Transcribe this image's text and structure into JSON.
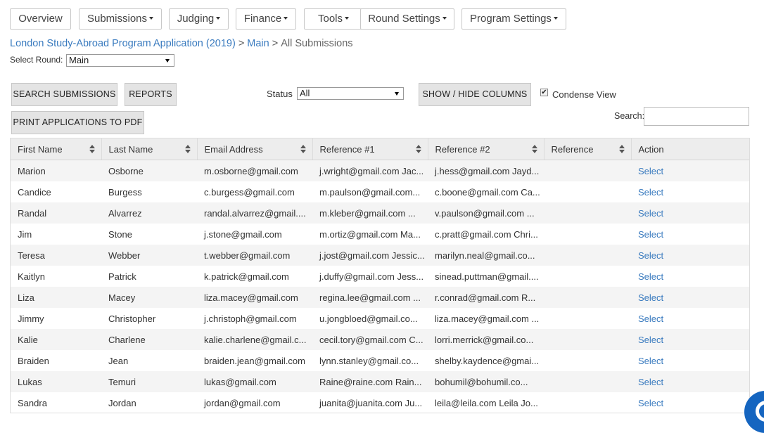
{
  "nav": [
    {
      "label": "Overview",
      "dropdown": false
    },
    {
      "label": "Submissions",
      "dropdown": true
    },
    {
      "label": "Judging",
      "dropdown": true
    },
    {
      "label": "Finance",
      "dropdown": true
    },
    {
      "label": "Tools",
      "dropdown": true
    },
    {
      "label": "Round Settings",
      "dropdown": true
    },
    {
      "label": "Program Settings",
      "dropdown": true
    }
  ],
  "breadcrumb": {
    "program": "London Study-Abroad Program Application (2019)",
    "round": "Main",
    "current": "All Submissions",
    "separator": ">"
  },
  "round_select": {
    "label": "Select Round:",
    "value": "Main"
  },
  "toolbar": {
    "search_submissions": "SEARCH SUBMISSIONS",
    "reports": "REPORTS",
    "print_pdf": "PRINT APPLICATIONS TO PDF",
    "status_label": "Status",
    "status_value": "All",
    "show_hide_columns": "SHOW / HIDE COLUMNS",
    "condense_label": "Condense View",
    "condense_checked": true,
    "search_label": "Search:",
    "search_value": ""
  },
  "table": {
    "columns": [
      "First Name",
      "Last Name",
      "Email Address",
      "Reference #1",
      "Reference #2",
      "Reference",
      "Action"
    ],
    "rows": [
      [
        "Marion",
        "Osborne",
        "m.osborne@gmail.com",
        "j.wright@gmail.com Jac...",
        "j.hess@gmail.com Jayd...",
        "",
        "Select"
      ],
      [
        "Candice",
        "Burgess",
        "c.burgess@gmail.com",
        "m.paulson@gmail.com...",
        "c.boone@gmail.com Ca...",
        "",
        "Select"
      ],
      [
        "Randal",
        "Alvarrez",
        "randal.alvarrez@gmail....",
        "m.kleber@gmail.com ...",
        "v.paulson@gmail.com ...",
        "",
        "Select"
      ],
      [
        "Jim",
        "Stone",
        "j.stone@gmail.com",
        "m.ortiz@gmail.com Ma...",
        "c.pratt@gmail.com Chri...",
        "",
        "Select"
      ],
      [
        "Teresa",
        "Webber",
        "t.webber@gmail.com",
        "j.jost@gmail.com Jessic...",
        "marilyn.neal@gmail.co...",
        "",
        "Select"
      ],
      [
        "Kaitlyn",
        "Patrick",
        "k.patrick@gmail.com",
        "j.duffy@gmail.com Jess...",
        "sinead.puttman@gmail....",
        "",
        "Select"
      ],
      [
        "Liza",
        "Macey",
        "liza.macey@gmail.com",
        "regina.lee@gmail.com ...",
        "r.conrad@gmail.com R...",
        "",
        "Select"
      ],
      [
        "Jimmy",
        "Christopher",
        "j.christoph@gmail.com",
        "u.jongbloed@gmail.co...",
        "liza.macey@gmail.com ...",
        "",
        "Select"
      ],
      [
        "Kalie",
        "Charlene",
        "kalie.charlene@gmail.c...",
        "cecil.tory@gmail.com C...",
        "lorri.merrick@gmail.co...",
        "",
        "Select"
      ],
      [
        "Braiden",
        "Jean",
        "braiden.jean@gmail.com",
        "lynn.stanley@gmail.co...",
        "shelby.kaydence@gmai...",
        "",
        "Select"
      ],
      [
        "Lukas",
        "Temuri",
        "lukas@gmail.com",
        "Raine@raine.com Rain...",
        "bohumil@bohumil.co...",
        "",
        "Select"
      ],
      [
        "Sandra",
        "Jordan",
        "jordan@gmail.com",
        "juanita@juanita.com Ju...",
        "leila@leila.com Leila Jo...",
        "",
        "Select"
      ]
    ]
  },
  "colors": {
    "link": "#3a7bbf",
    "header_bg": "#ededed",
    "button_bg": "#e4e4e4",
    "chat": "#1565c0"
  },
  "icons": {
    "sort": "sort-icon",
    "caret": "caret-down-icon",
    "checkbox": "checkmark-icon",
    "chat": "chat-icon"
  }
}
